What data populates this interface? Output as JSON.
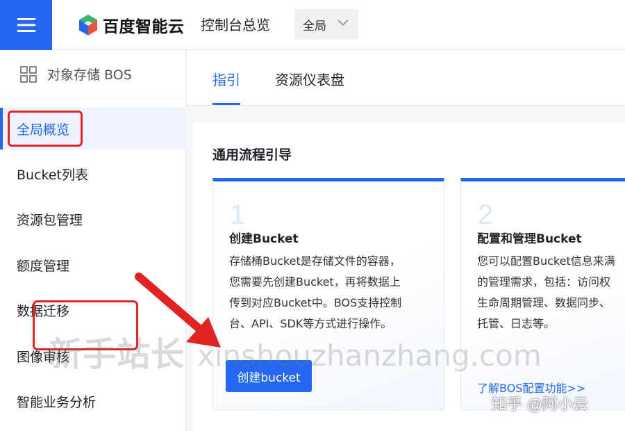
{
  "header": {
    "menu_icon": "hamburger-menu-icon",
    "brand_name": "百度智能云",
    "console_title": "控制台总览",
    "region_select": {
      "value": "全局",
      "icon": "chevron-down-icon"
    }
  },
  "sidebar": {
    "product_title": "对象存储 BOS",
    "product_icon": "grid-icon",
    "items": [
      {
        "label": "全局概览",
        "active": true
      },
      {
        "label": "Bucket列表"
      },
      {
        "label": "资源包管理"
      },
      {
        "label": "额度管理"
      },
      {
        "label": "数据迁移"
      },
      {
        "label": "图像审核"
      },
      {
        "label": "智能业务分析"
      }
    ]
  },
  "main": {
    "tabs": [
      {
        "label": "指引",
        "active": true
      },
      {
        "label": "资源仪表盘"
      }
    ],
    "section_title": "通用流程引导",
    "cards": [
      {
        "step": "1",
        "title": "创建Bucket",
        "description_lines": [
          "存储桶Bucket是存储文件的容器，",
          "您需要先创建Bucket，再将数据上",
          "传到对应Bucket中。BOS支持控制",
          "台、API、SDK等方式进行操作。"
        ],
        "button_label": "创建bucket"
      },
      {
        "step": "2",
        "title": "配置和管理Bucket",
        "description_lines": [
          "您可以配置Bucket信息来满",
          "的管理需求，包括：访问权",
          "生命周期管理、数据同步、",
          "托管、日志等。"
        ],
        "link_label": "了解BOS配置功能>>"
      }
    ]
  },
  "overlay": {
    "watermark_cn": "新手站长",
    "watermark_latin": "xinshouzhanzhang.com",
    "author_mark": "知乎 @阿小云"
  },
  "colors": {
    "brand_blue": "#2468f2",
    "highlight_red": "#e02323"
  }
}
